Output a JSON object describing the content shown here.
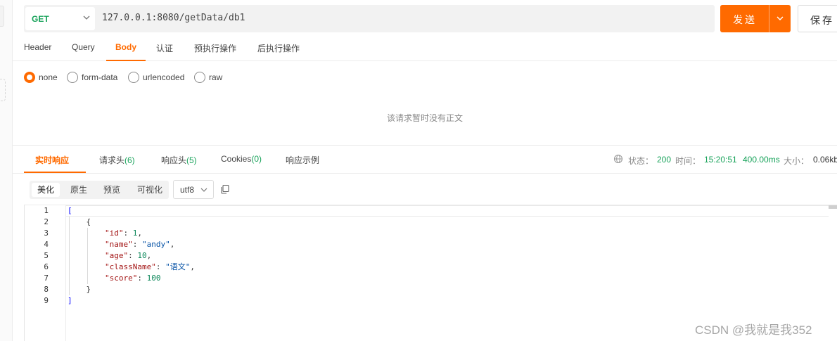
{
  "request": {
    "method": "GET",
    "url": "127.0.0.1:8080/getData/db1",
    "send_label": "发送",
    "save_label": "保存"
  },
  "request_tabs": [
    "Header",
    "Query",
    "Body",
    "认证",
    "预执行操作",
    "后执行操作"
  ],
  "request_tab_active": "Body",
  "body_types": [
    "none",
    "form-data",
    "urlencoded",
    "raw"
  ],
  "body_type_selected": "none",
  "empty_body_text": "该请求暂时没有正文",
  "response_tabs": [
    {
      "label": "实时响应",
      "count": ""
    },
    {
      "label": "请求头",
      "count": "(6)"
    },
    {
      "label": "响应头",
      "count": "(5)"
    },
    {
      "label": "Cookies",
      "count": "(0)"
    },
    {
      "label": "响应示例",
      "count": ""
    }
  ],
  "response_tab_active": "实时响应",
  "status": {
    "status_label": "状态：",
    "status_value": "200",
    "time_label": "时间：",
    "time_value": "15:20:51",
    "duration_value": "400.00ms",
    "size_label": "大小：",
    "size_value": "0.06kb"
  },
  "view_modes": [
    "美化",
    "原生",
    "预览",
    "可视化"
  ],
  "view_mode_active": "美化",
  "encoding": "utf8",
  "code": {
    "line_numbers": [
      "1",
      "2",
      "3",
      "4",
      "5",
      "6",
      "7",
      "8",
      "9"
    ],
    "lines": [
      "[",
      "    {",
      "        \"id\": 1,",
      "        \"name\": \"andy\",",
      "        \"age\": 10,",
      "        \"className\": \"语文\",",
      "        \"score\": 100",
      "    }",
      "]"
    ]
  },
  "watermark": "CSDN @我就是我352",
  "colors": {
    "accent": "#ff6a00",
    "method_get": "#19a35b",
    "status_ok": "#19a35b"
  }
}
